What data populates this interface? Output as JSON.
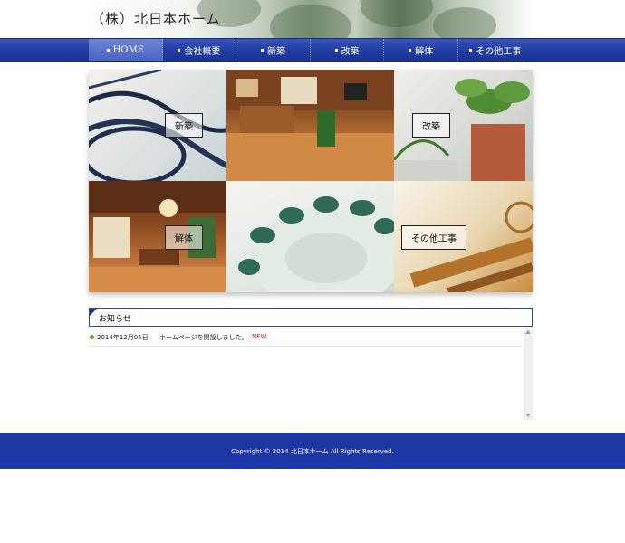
{
  "header": {
    "logo": "（株）北日本ホーム"
  },
  "nav": {
    "items": [
      {
        "label": "HOME",
        "active": true
      },
      {
        "label": "会社概要",
        "active": false
      },
      {
        "label": "新築",
        "active": false
      },
      {
        "label": "改築",
        "active": false
      },
      {
        "label": "解体",
        "active": false
      },
      {
        "label": "その他工事",
        "active": false
      }
    ]
  },
  "grid": {
    "labels": {
      "new_build": "新築",
      "renovation": "改築",
      "demolition": "解体",
      "other": "その他工事"
    }
  },
  "news": {
    "title": "お知らせ",
    "items": [
      {
        "date": "2014年12月05日",
        "text": "ホームページを開設しました。",
        "badge": "NEW"
      }
    ]
  },
  "footer": {
    "copyright": "Copyright © 2014 北日本ホーム All Rights Reserved."
  },
  "colors": {
    "nav": "#2340a6",
    "footer": "#1d37a4",
    "new_badge": "#e02020",
    "bullet": "#6aa035"
  }
}
